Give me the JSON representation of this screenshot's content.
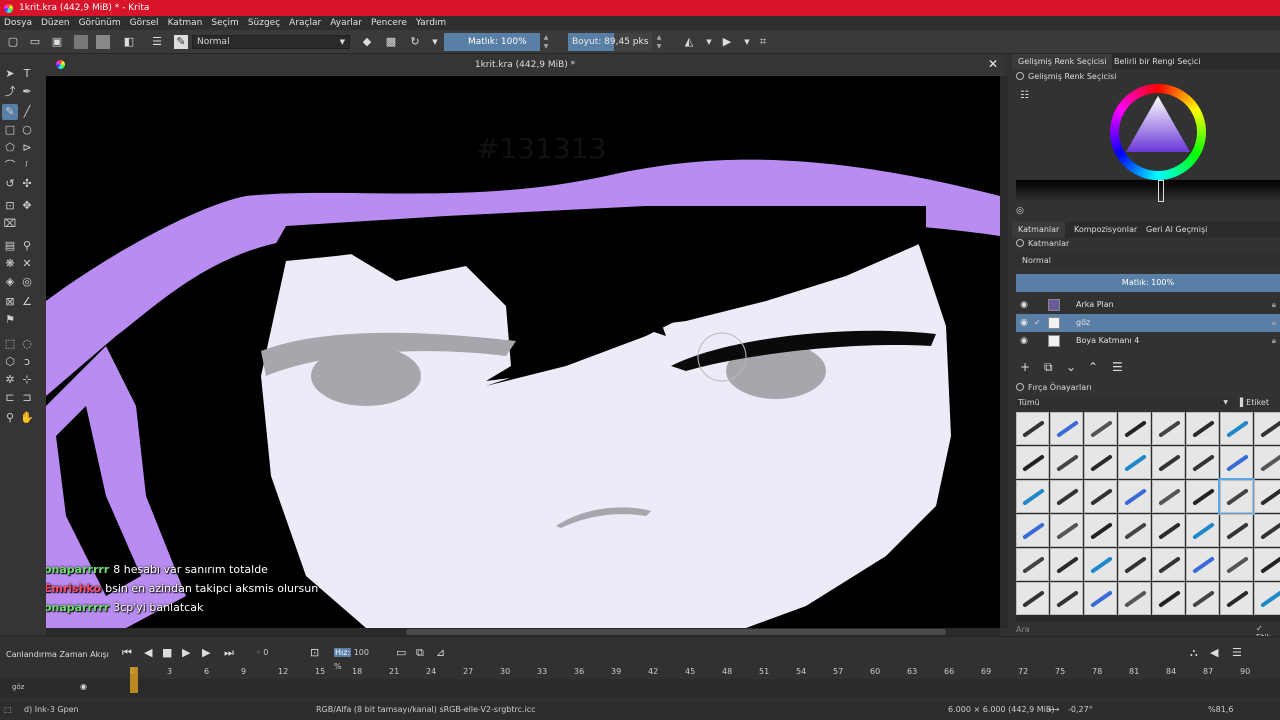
{
  "window": {
    "title": "1krit.kra (442,9 MiB) * - Krita",
    "app_icon": "krita-icon"
  },
  "menu": [
    "Dosya",
    "Düzen",
    "Görünüm",
    "Görsel",
    "Katman",
    "Seçim",
    "Süzgeç",
    "Araçlar",
    "Ayarlar",
    "Pencere",
    "Yardım"
  ],
  "toolbar": {
    "blend_mode": "Normal",
    "opacity_label": "Matlık: 100%",
    "size_label": "Boyut:",
    "size_value": "89,45 pks"
  },
  "document": {
    "tab_title": "1krit.kra (442,9 MiB) *",
    "overlay_text": "#131313"
  },
  "chat": [
    {
      "user": "onaparrrrr",
      "user_color": "#6fe06f",
      "message": "8 hesabı var sanırım totalde"
    },
    {
      "user": "Emrishko",
      "user_color": "#ff4d6a",
      "message": "bsin en azindan takipci aksmis olursun"
    },
    {
      "user": "onaparrrrr",
      "user_color": "#6fe06f",
      "message": "3cp'yi banlatcak"
    }
  ],
  "dock": {
    "color_tabs": [
      "Gelişmiş Renk Seçicisi",
      "Belirli bir Rengi Seçici"
    ],
    "color_panel_title": "Gelişmiş Renk Seçicisi",
    "layer_tabs": [
      "Katmanlar",
      "Kompozisyonlar",
      "Geri Al Geçmişi"
    ],
    "layers_title": "Katmanlar",
    "layer_blend": "Normal",
    "layer_opacity": "Matlık:  100%",
    "layers": [
      {
        "name": "Arka Plan",
        "selected": false,
        "thumb": "dark"
      },
      {
        "name": "göz",
        "selected": true,
        "thumb": "light"
      },
      {
        "name": "Boya Katmanı 4",
        "selected": false,
        "thumb": "light"
      }
    ],
    "brush_title": "Fırça Önayarları",
    "brush_filter": "Tümü",
    "brush_tag": "Etiket",
    "brush_search_placeholder": "Ara",
    "brush_filter_label": "Etik"
  },
  "timeline": {
    "title": "Canlandırma Zaman Akışı",
    "frame": "0",
    "speed_label": "Hız:",
    "speed_value": "100 %",
    "ticks": [
      "0",
      "3",
      "6",
      "9",
      "12",
      "15",
      "18",
      "21",
      "24",
      "27",
      "30",
      "33",
      "36",
      "39",
      "42",
      "45",
      "48",
      "51",
      "54",
      "57",
      "60",
      "63",
      "66",
      "69",
      "72",
      "75",
      "78",
      "81",
      "84",
      "87",
      "90"
    ],
    "layer_name": "göz"
  },
  "status": {
    "brush": "d) Ink-3 Gpen",
    "color_info": "RGB/Alfa (8 bit tamsayı/kanal)  sRGB-elle-V2-srgbtrc.icc",
    "dimensions": "6.000 × 6.000 (442,9 MiB)",
    "rotation": "-0,27°",
    "zoom": "%81,6"
  },
  "colors": {
    "accent": "#5a7fa6",
    "titlebar": "#d8142a",
    "hair": "#b88cf0",
    "skin": "#eeeaf7"
  }
}
